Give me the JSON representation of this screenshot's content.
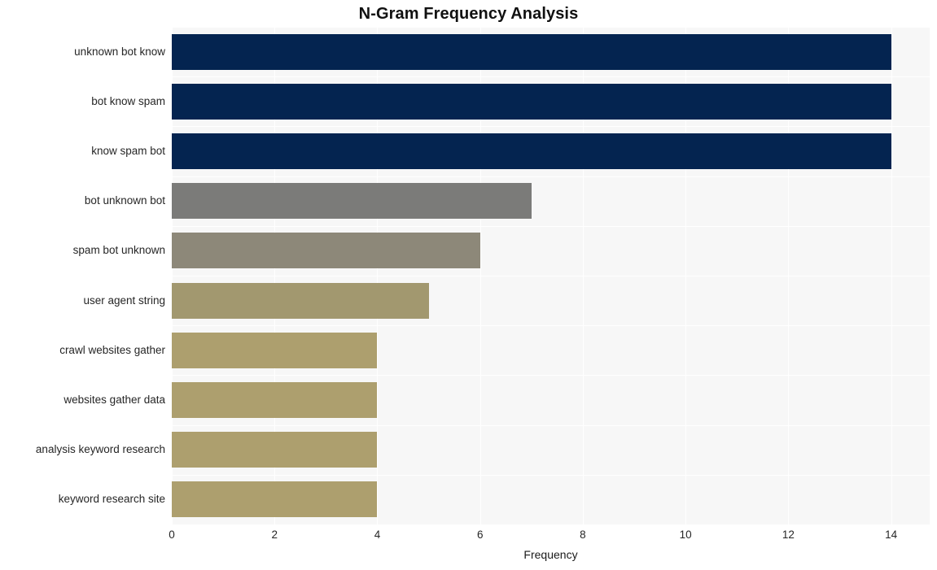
{
  "chart_data": {
    "type": "bar",
    "orientation": "horizontal",
    "title": "N-Gram Frequency Analysis",
    "xlabel": "Frequency",
    "ylabel": "",
    "xlim": [
      0,
      14.75
    ],
    "ylim": [
      0,
      10
    ],
    "grid": true,
    "legend": null,
    "categories": [
      "unknown bot know",
      "bot know spam",
      "know spam bot",
      "bot unknown bot",
      "spam bot unknown",
      "user agent string",
      "crawl websites gather",
      "websites gather data",
      "analysis keyword research",
      "keyword research site"
    ],
    "values": [
      14,
      14,
      14,
      7,
      6,
      5,
      4,
      4,
      4,
      4
    ],
    "bar_colors": [
      "#042450",
      "#042450",
      "#042450",
      "#7b7b79",
      "#8d8879",
      "#a2986f",
      "#ad9f6e",
      "#ad9f6e",
      "#ad9f6e",
      "#ad9f6e"
    ],
    "xticks": [
      0,
      2,
      4,
      6,
      8,
      10,
      12,
      14
    ],
    "xtick_labels": [
      "0",
      "2",
      "4",
      "6",
      "8",
      "10",
      "12",
      "14"
    ],
    "plot_background": "#f7f7f7",
    "figure_background": "#ffffff",
    "grid_color": "#ffffff"
  }
}
